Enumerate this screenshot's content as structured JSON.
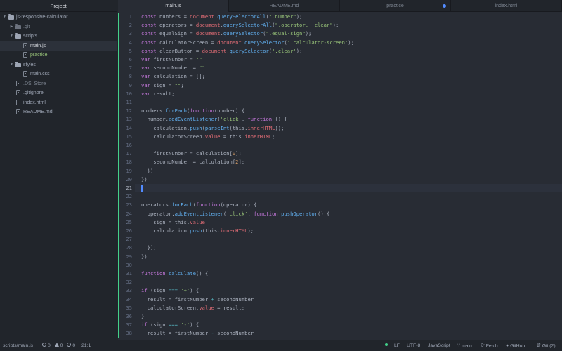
{
  "sidebar": {
    "title": "Project",
    "items": [
      {
        "label": "js-responsive-calculator",
        "kind": "folder",
        "expanded": true,
        "depth": 0,
        "name": "tree-root-js-responsive-calculator",
        "status": "normal"
      },
      {
        "label": ".git",
        "kind": "folder",
        "expanded": false,
        "depth": 1,
        "name": "tree-folder-git",
        "status": "dim"
      },
      {
        "label": "scripts",
        "kind": "folder",
        "expanded": true,
        "depth": 1,
        "name": "tree-folder-scripts",
        "status": "normal"
      },
      {
        "label": "main.js",
        "kind": "file",
        "depth": 2,
        "name": "tree-file-main-js",
        "status": "normal",
        "selected": true
      },
      {
        "label": "practice",
        "kind": "file",
        "depth": 2,
        "name": "tree-file-practice",
        "status": "modified"
      },
      {
        "label": "styles",
        "kind": "folder",
        "expanded": true,
        "depth": 1,
        "name": "tree-folder-styles",
        "status": "normal"
      },
      {
        "label": "main.css",
        "kind": "file",
        "depth": 2,
        "name": "tree-file-main-css",
        "status": "normal"
      },
      {
        "label": ".DS_Store",
        "kind": "file",
        "depth": 1,
        "name": "tree-file-ds-store",
        "status": "dim"
      },
      {
        "label": ".gitignore",
        "kind": "file",
        "depth": 1,
        "name": "tree-file-gitignore",
        "status": "normal"
      },
      {
        "label": "index.html",
        "kind": "file",
        "depth": 1,
        "name": "tree-file-index-html",
        "status": "normal"
      },
      {
        "label": "README.md",
        "kind": "file",
        "depth": 1,
        "name": "tree-file-readme-md",
        "status": "normal"
      }
    ]
  },
  "tabs": [
    {
      "label": "main.js",
      "active": true,
      "modified": false,
      "name": "tab-main-js"
    },
    {
      "label": "README.md",
      "active": false,
      "modified": false,
      "name": "tab-readme-md"
    },
    {
      "label": "practice",
      "active": false,
      "modified": true,
      "name": "tab-practice"
    },
    {
      "label": "index.html",
      "active": false,
      "modified": false,
      "name": "tab-index-html"
    }
  ],
  "editor": {
    "cursor_line": 21,
    "code": [
      [
        [
          "const ",
          "keyword"
        ],
        [
          "numbers",
          "plain"
        ],
        [
          " = ",
          "plain"
        ],
        [
          "document",
          "var"
        ],
        [
          ".",
          "punct"
        ],
        [
          "querySelectorAll",
          "func"
        ],
        [
          "(",
          "punct"
        ],
        [
          "\".number\"",
          "string"
        ],
        [
          ");",
          "punct"
        ]
      ],
      [
        [
          "const ",
          "keyword"
        ],
        [
          "operators",
          "plain"
        ],
        [
          " = ",
          "plain"
        ],
        [
          "document",
          "var"
        ],
        [
          ".",
          "punct"
        ],
        [
          "querySelectorAll",
          "func"
        ],
        [
          "(",
          "punct"
        ],
        [
          "\".operator, .clear\"",
          "string"
        ],
        [
          ");",
          "punct"
        ]
      ],
      [
        [
          "const ",
          "keyword"
        ],
        [
          "equalSign",
          "plain"
        ],
        [
          " = ",
          "plain"
        ],
        [
          "document",
          "var"
        ],
        [
          ".",
          "punct"
        ],
        [
          "querySelector",
          "func"
        ],
        [
          "(",
          "punct"
        ],
        [
          "\".equal-sign\"",
          "string"
        ],
        [
          ");",
          "punct"
        ]
      ],
      [
        [
          "const ",
          "keyword"
        ],
        [
          "calculatorScreen",
          "plain"
        ],
        [
          " = ",
          "plain"
        ],
        [
          "document",
          "var"
        ],
        [
          ".",
          "punct"
        ],
        [
          "querySelector",
          "func"
        ],
        [
          "(",
          "punct"
        ],
        [
          "'.calculator-screen'",
          "string"
        ],
        [
          ");",
          "punct"
        ]
      ],
      [
        [
          "const ",
          "keyword"
        ],
        [
          "clearButton",
          "plain"
        ],
        [
          " = ",
          "plain"
        ],
        [
          "document",
          "var"
        ],
        [
          ".",
          "punct"
        ],
        [
          "querySelector",
          "func"
        ],
        [
          "(",
          "punct"
        ],
        [
          "'.clear'",
          "string"
        ],
        [
          ");",
          "punct"
        ]
      ],
      [
        [
          "var ",
          "keyword"
        ],
        [
          "firstNumber",
          "plain"
        ],
        [
          " = ",
          "plain"
        ],
        [
          "\"\"",
          "string"
        ]
      ],
      [
        [
          "var ",
          "keyword"
        ],
        [
          "secondNumber",
          "plain"
        ],
        [
          " = ",
          "plain"
        ],
        [
          "\"\"",
          "string"
        ]
      ],
      [
        [
          "var ",
          "keyword"
        ],
        [
          "calculation",
          "plain"
        ],
        [
          " = [];",
          "plain"
        ]
      ],
      [
        [
          "var ",
          "keyword"
        ],
        [
          "sign",
          "plain"
        ],
        [
          " = ",
          "plain"
        ],
        [
          "\"\"",
          "string"
        ],
        [
          ";",
          "punct"
        ]
      ],
      [
        [
          "var ",
          "keyword"
        ],
        [
          "result;",
          "plain"
        ]
      ],
      [],
      [
        [
          "numbers",
          "plain"
        ],
        [
          ".",
          "punct"
        ],
        [
          "forEach",
          "func"
        ],
        [
          "(",
          "punct"
        ],
        [
          "function",
          "keyword"
        ],
        [
          "(number) {",
          "plain"
        ]
      ],
      [
        [
          "  number",
          "plain"
        ],
        [
          ".",
          "punct"
        ],
        [
          "addEventListener",
          "func"
        ],
        [
          "(",
          "punct"
        ],
        [
          "'click'",
          "string"
        ],
        [
          ", ",
          "plain"
        ],
        [
          "function",
          "keyword"
        ],
        [
          " () {",
          "plain"
        ]
      ],
      [
        [
          "    calculation",
          "plain"
        ],
        [
          ".",
          "punct"
        ],
        [
          "push",
          "func"
        ],
        [
          "(",
          "punct"
        ],
        [
          "parseInt",
          "func"
        ],
        [
          "(",
          "punct"
        ],
        [
          "this",
          "plain"
        ],
        [
          ".",
          "punct"
        ],
        [
          "innerHTML",
          "var"
        ],
        [
          "));",
          "punct"
        ]
      ],
      [
        [
          "    calculatorScreen",
          "plain"
        ],
        [
          ".",
          "punct"
        ],
        [
          "value",
          "var"
        ],
        [
          " = ",
          "plain"
        ],
        [
          "this",
          "plain"
        ],
        [
          ".",
          "punct"
        ],
        [
          "innerHTML",
          "var"
        ],
        [
          ";",
          "punct"
        ]
      ],
      [],
      [
        [
          "    firstNumber = calculation[",
          "plain"
        ],
        [
          "0",
          "number"
        ],
        [
          "];",
          "plain"
        ]
      ],
      [
        [
          "    secondNumber = calculation[",
          "plain"
        ],
        [
          "2",
          "number"
        ],
        [
          "];",
          "plain"
        ]
      ],
      [
        [
          "  })",
          "plain"
        ]
      ],
      [
        [
          "})",
          "plain"
        ]
      ],
      [],
      [],
      [
        [
          "operators",
          "plain"
        ],
        [
          ".",
          "punct"
        ],
        [
          "forEach",
          "func"
        ],
        [
          "(",
          "punct"
        ],
        [
          "function",
          "keyword"
        ],
        [
          "(operator) {",
          "plain"
        ]
      ],
      [
        [
          "  operator",
          "plain"
        ],
        [
          ".",
          "punct"
        ],
        [
          "addEventListener",
          "func"
        ],
        [
          "(",
          "punct"
        ],
        [
          "'click'",
          "string"
        ],
        [
          ", ",
          "plain"
        ],
        [
          "function ",
          "keyword"
        ],
        [
          "pushOperator",
          "func"
        ],
        [
          "() {",
          "plain"
        ]
      ],
      [
        [
          "    sign = ",
          "plain"
        ],
        [
          "this",
          "plain"
        ],
        [
          ".",
          "punct"
        ],
        [
          "value",
          "var"
        ]
      ],
      [
        [
          "    calculation",
          "plain"
        ],
        [
          ".",
          "punct"
        ],
        [
          "push",
          "func"
        ],
        [
          "(",
          "punct"
        ],
        [
          "this",
          "plain"
        ],
        [
          ".",
          "punct"
        ],
        [
          "innerHTML",
          "var"
        ],
        [
          ");",
          "punct"
        ]
      ],
      [],
      [
        [
          "  });",
          "plain"
        ]
      ],
      [
        [
          "})",
          "plain"
        ]
      ],
      [],
      [
        [
          "function ",
          "keyword"
        ],
        [
          "calculate",
          "func"
        ],
        [
          "() {",
          "plain"
        ]
      ],
      [],
      [
        [
          "if ",
          "keyword"
        ],
        [
          "(sign ",
          "plain"
        ],
        [
          "===",
          "op"
        ],
        [
          " ",
          "plain"
        ],
        [
          "'+'",
          "string"
        ],
        [
          ") {",
          "plain"
        ]
      ],
      [
        [
          "  result = firstNumber ",
          "plain"
        ],
        [
          "+",
          "op"
        ],
        [
          " secondNumber",
          "plain"
        ]
      ],
      [
        [
          "  calculatorScreen",
          "plain"
        ],
        [
          ".",
          "punct"
        ],
        [
          "value",
          "var"
        ],
        [
          " = result;",
          "plain"
        ]
      ],
      [
        [
          "}",
          "plain"
        ]
      ],
      [
        [
          "if ",
          "keyword"
        ],
        [
          "(sign ",
          "plain"
        ],
        [
          "===",
          "op"
        ],
        [
          " ",
          "plain"
        ],
        [
          "'-'",
          "string"
        ],
        [
          ") {",
          "plain"
        ]
      ],
      [
        [
          "  result = firstNumber ",
          "plain"
        ],
        [
          "-",
          "op"
        ],
        [
          " secondNumber",
          "plain"
        ]
      ]
    ]
  },
  "statusbar": {
    "file_path": "scripts/main.js",
    "errors": "0",
    "warnings": "0",
    "infos": "0",
    "cursor_position": "21:1",
    "line_ending": "LF",
    "encoding": "UTF-8",
    "grammar": "JavaScript",
    "branch": "main",
    "fetch_label": "Fetch",
    "github_label": "GitHub",
    "git_label": "Git (2)"
  },
  "colors": {
    "accent": "#528bff",
    "git_modified": "#43d08a",
    "keyword": "#c678dd",
    "function": "#61afef",
    "string": "#98c379",
    "variable": "#e06c75",
    "number": "#d19a66"
  }
}
